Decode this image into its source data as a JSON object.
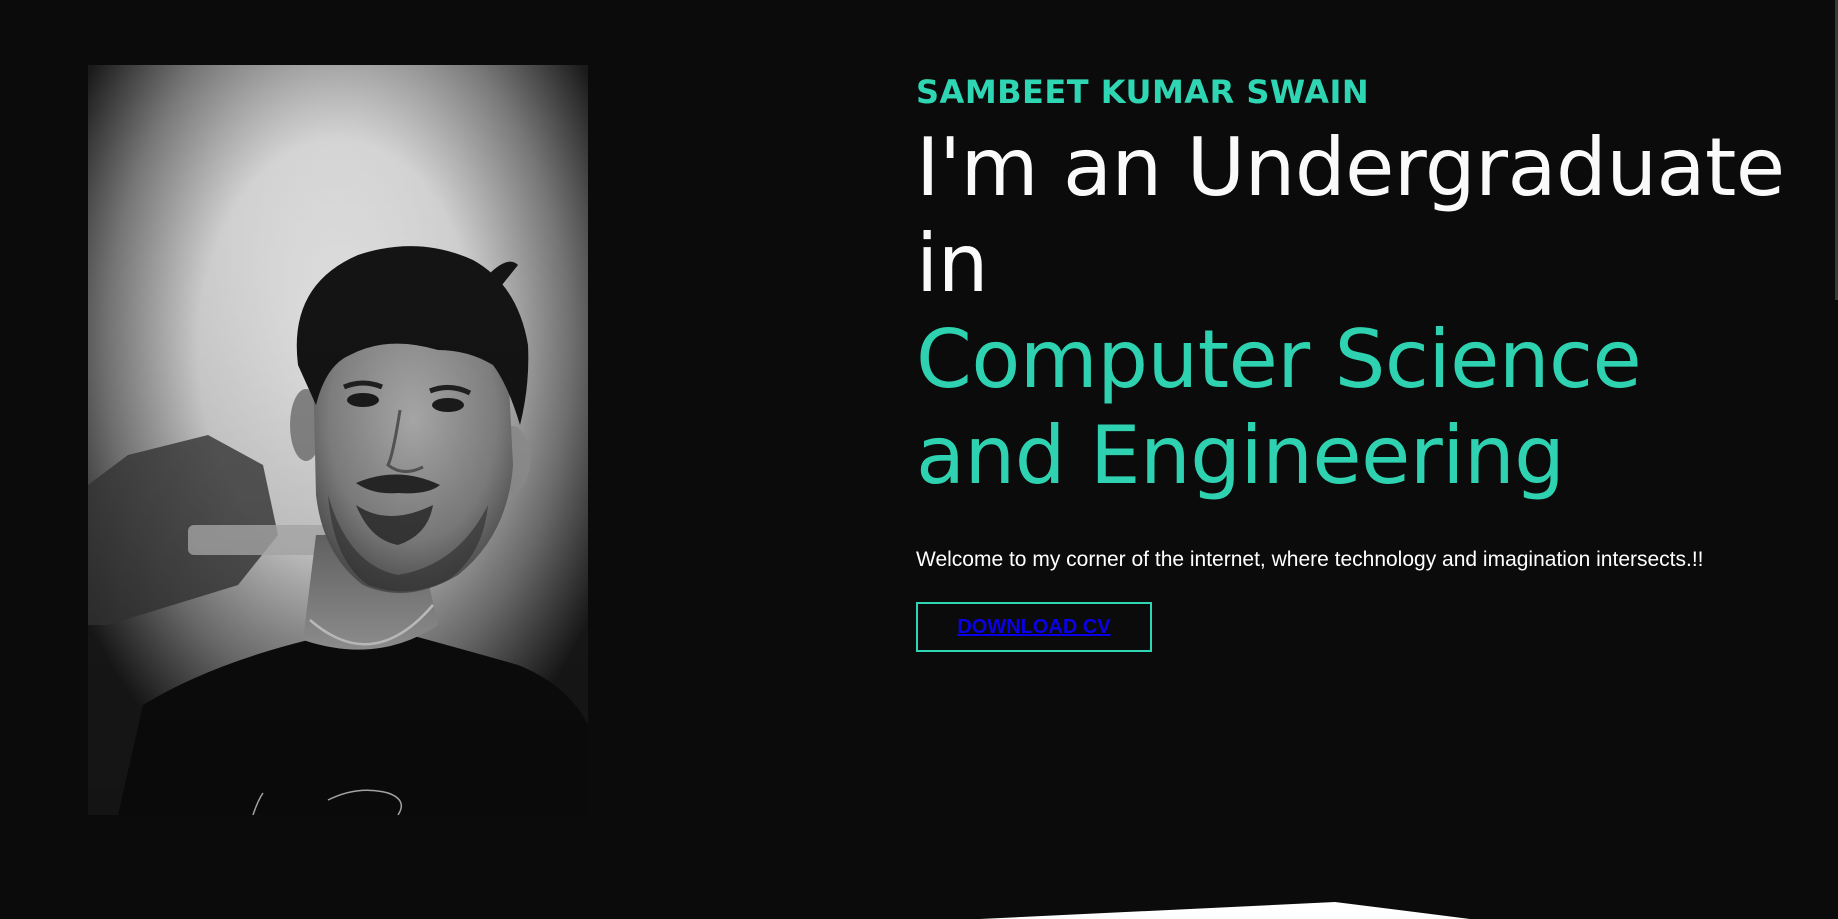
{
  "hero": {
    "name": "SAMBEET KUMAR SWAIN",
    "intro_line1": "I'm an Undergraduate",
    "intro_line2": "in",
    "field_line1": "Computer Science",
    "field_line2": "and Engineering",
    "tagline": "Welcome to my corner of the internet, where technology and imagination intersects.!!",
    "cta_label": "DOWNLOAD CV"
  },
  "colors": {
    "background": "#0b0b0b",
    "accent": "#2fd6b4",
    "text": "#ffffff",
    "link": "#0b00e6"
  },
  "portrait": {
    "icon": "profile-photo"
  }
}
